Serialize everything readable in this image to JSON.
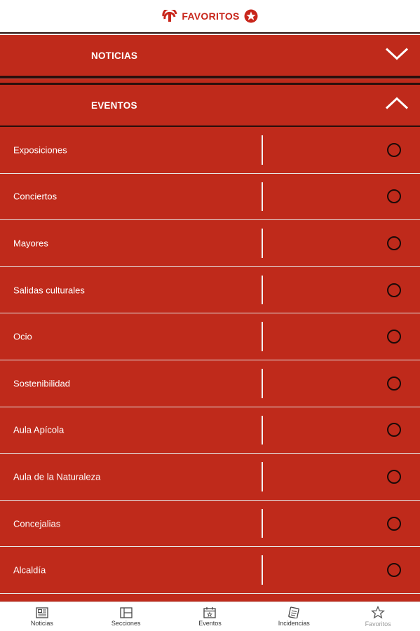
{
  "header": {
    "title": "FAVORITOS",
    "logo_icon": "city-logo-icon",
    "badge_icon": "star-badge-icon",
    "accent": "#c8261b"
  },
  "sections": [
    {
      "label": "NOTICIAS",
      "state_icon": "chevron-down-icon",
      "expanded": false
    },
    {
      "label": "EVENTOS",
      "state_icon": "chevron-up-icon",
      "expanded": true
    }
  ],
  "events": {
    "items": [
      {
        "label": "Exposiciones",
        "selected": false
      },
      {
        "label": "Conciertos",
        "selected": false
      },
      {
        "label": "Mayores",
        "selected": false
      },
      {
        "label": "Salidas culturales",
        "selected": false
      },
      {
        "label": "Ocio",
        "selected": false
      },
      {
        "label": "Sostenibilidad",
        "selected": false
      },
      {
        "label": "Aula Apícola",
        "selected": false
      },
      {
        "label": "Aula de la Naturaleza",
        "selected": false
      },
      {
        "label": "Concejalias",
        "selected": false
      },
      {
        "label": "Alcaldía",
        "selected": false
      }
    ]
  },
  "bottom_nav": {
    "items": [
      {
        "label": "Noticias",
        "icon": "newspaper-icon",
        "active": false
      },
      {
        "label": "Secciones",
        "icon": "sections-icon",
        "active": false
      },
      {
        "label": "Eventos",
        "icon": "calendar-icon",
        "active": false
      },
      {
        "label": "Incidencias",
        "icon": "incident-icon",
        "active": false
      },
      {
        "label": "Favoritos",
        "icon": "star-icon",
        "active": true
      }
    ]
  },
  "colors": {
    "primary_red": "#bf2a1b",
    "dark_separator": "#2a0f0c",
    "white": "#ffffff"
  }
}
